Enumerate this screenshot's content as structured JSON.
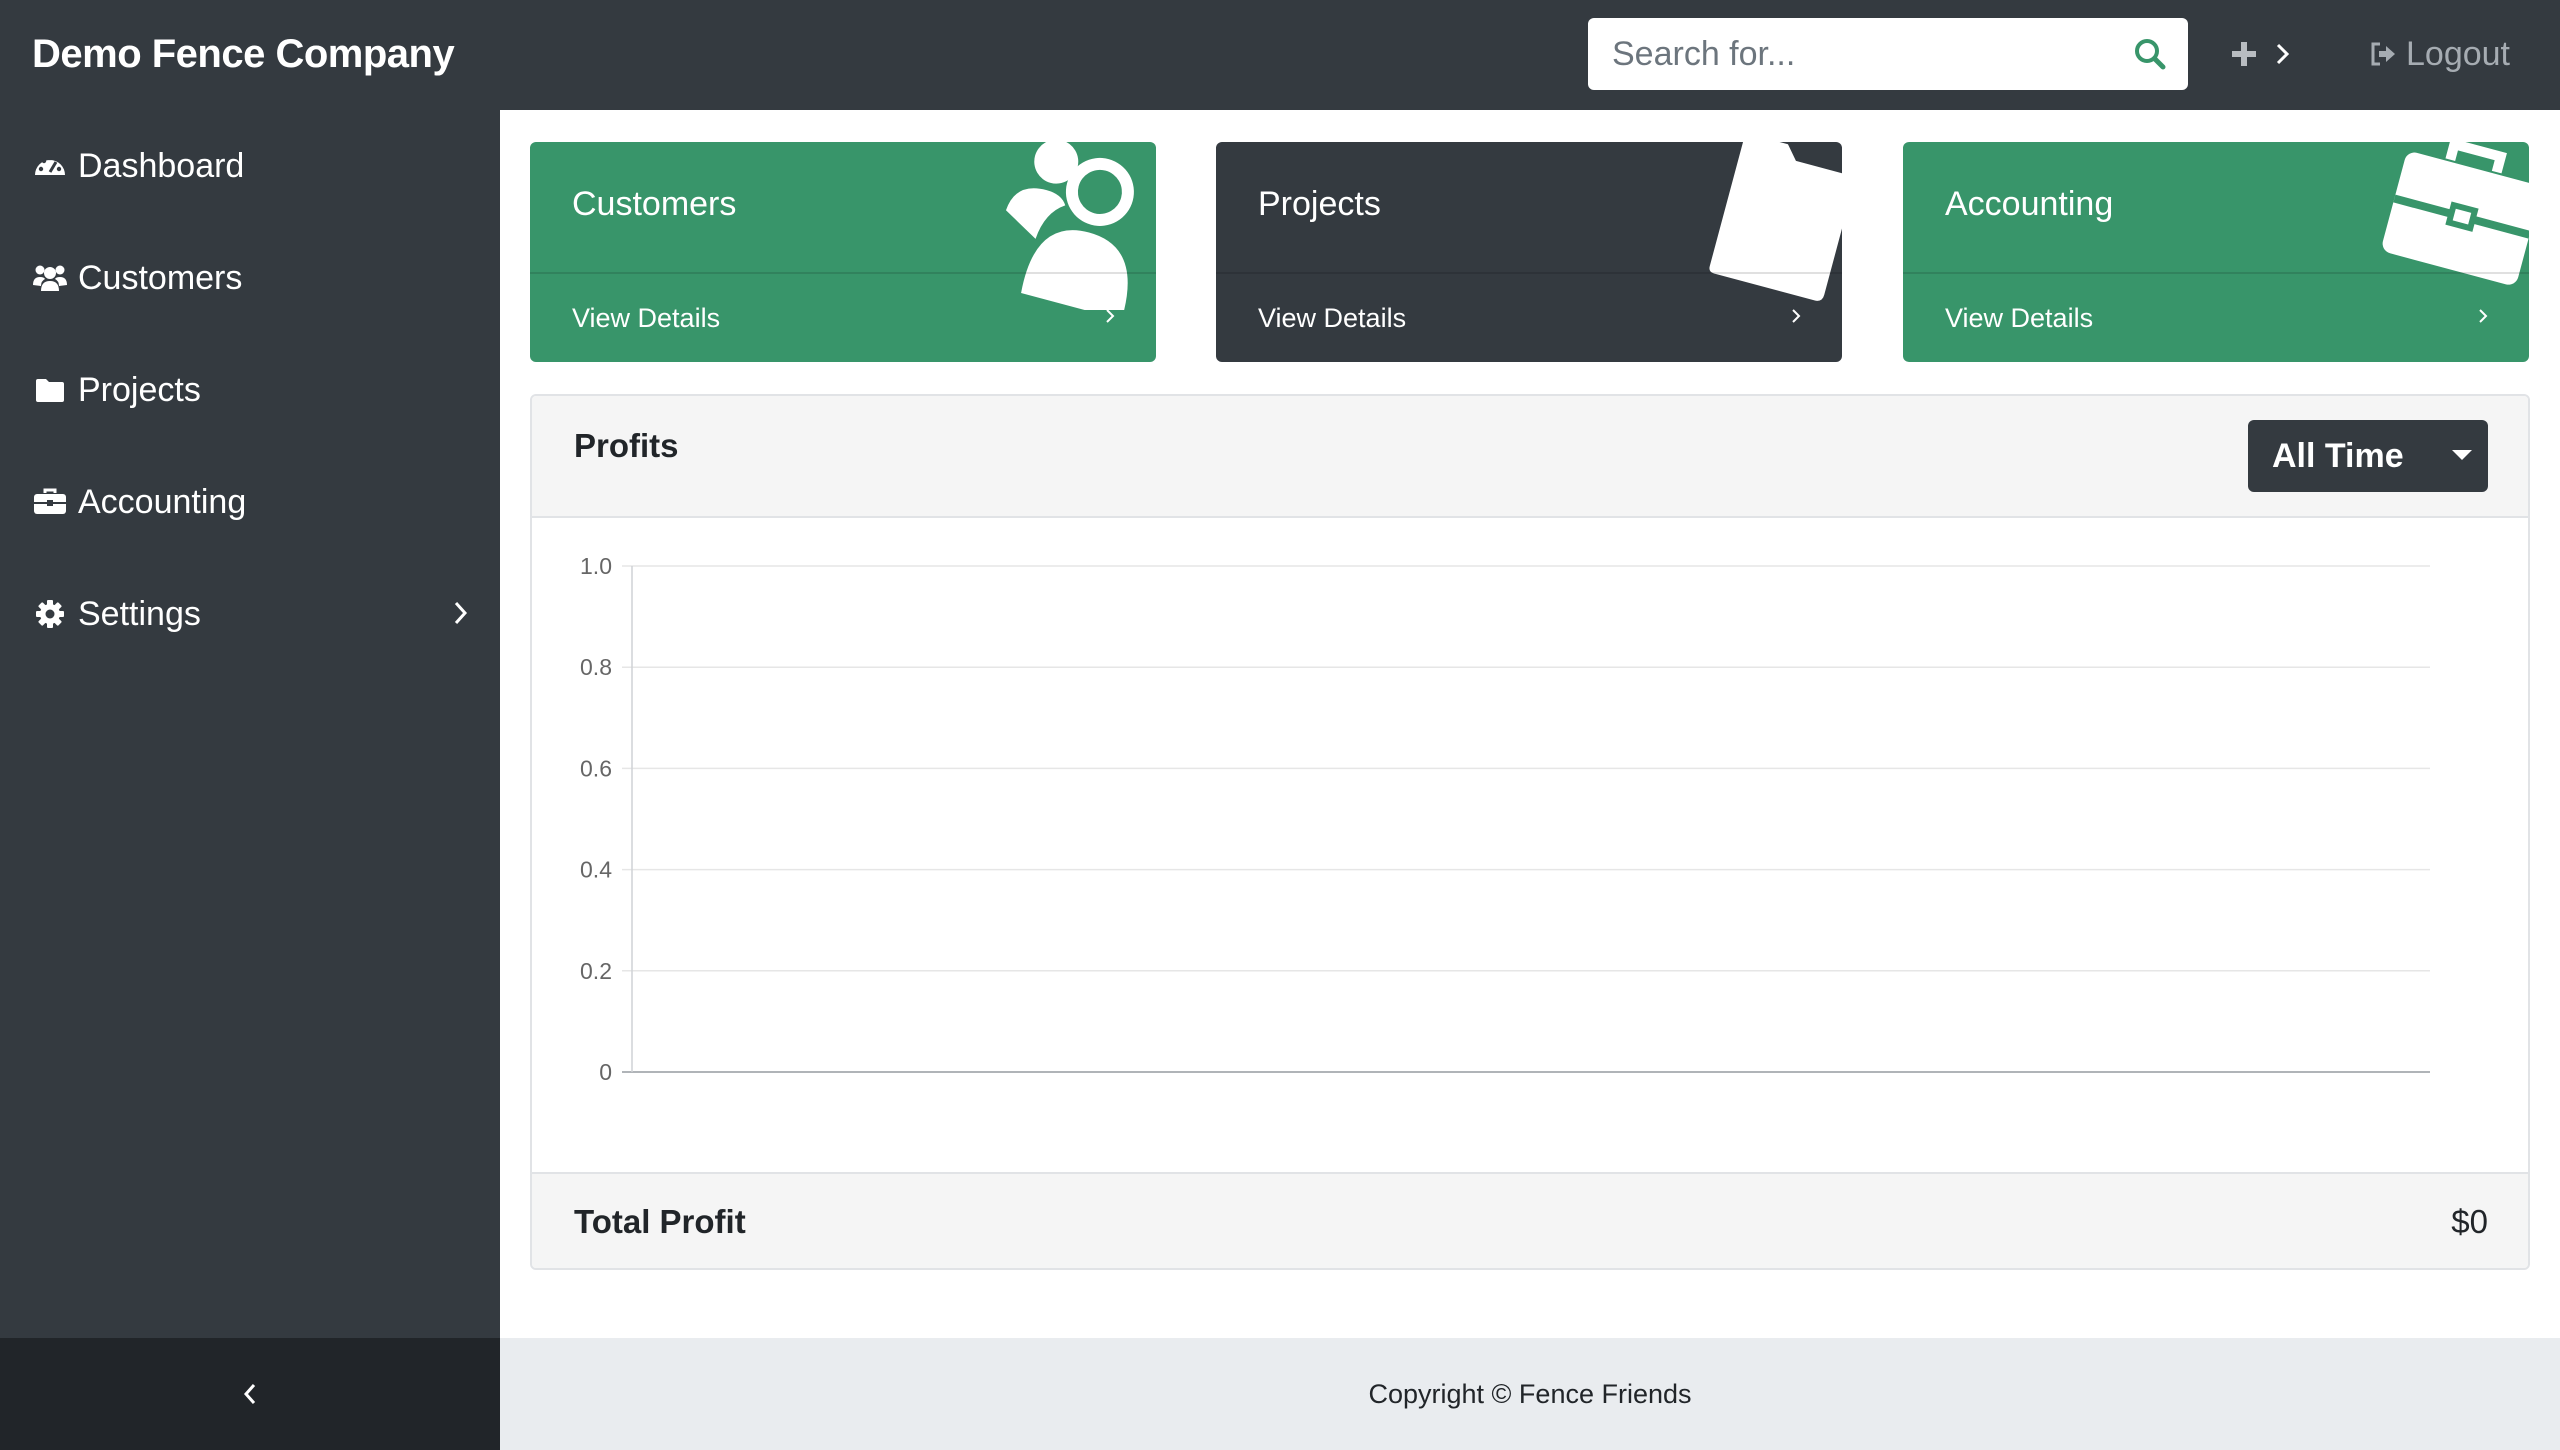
{
  "navbar": {
    "brand": "Demo Fence Company",
    "search_placeholder": "Search for...",
    "search_icon": "search-icon",
    "plus_icon": "plus-icon",
    "logout_label": "Logout",
    "accent_color": "#38956a"
  },
  "sidebar": {
    "items": [
      {
        "label": "Dashboard",
        "icon": "tachometer-icon"
      },
      {
        "label": "Customers",
        "icon": "users-icon"
      },
      {
        "label": "Projects",
        "icon": "folder-icon"
      },
      {
        "label": "Accounting",
        "icon": "briefcase-icon"
      },
      {
        "label": "Settings",
        "icon": "gear-icon"
      }
    ],
    "background": "#343a40"
  },
  "cards": [
    {
      "title": "Customers",
      "footer": "View Details",
      "color": "#38956a",
      "icon": "users-icon"
    },
    {
      "title": "Projects",
      "footer": "View Details",
      "color": "#343a40",
      "icon": "folder-icon"
    },
    {
      "title": "Accounting",
      "footer": "View Details",
      "color": "#38956a",
      "icon": "briefcase-icon"
    }
  ],
  "profits": {
    "title": "Profits",
    "range_selected": "All Time",
    "total_label": "Total Profit",
    "total_value": "$0"
  },
  "chart_data": {
    "type": "line",
    "title": "",
    "xlabel": "",
    "ylabel": "",
    "x": [],
    "series": [
      {
        "values": []
      }
    ],
    "yticks": [
      "0",
      "0.2",
      "0.4",
      "0.6",
      "0.8",
      "1.0"
    ],
    "ylim": [
      0,
      1
    ],
    "grid": true
  },
  "footer": {
    "copyright": "Copyright © Fence Friends"
  }
}
